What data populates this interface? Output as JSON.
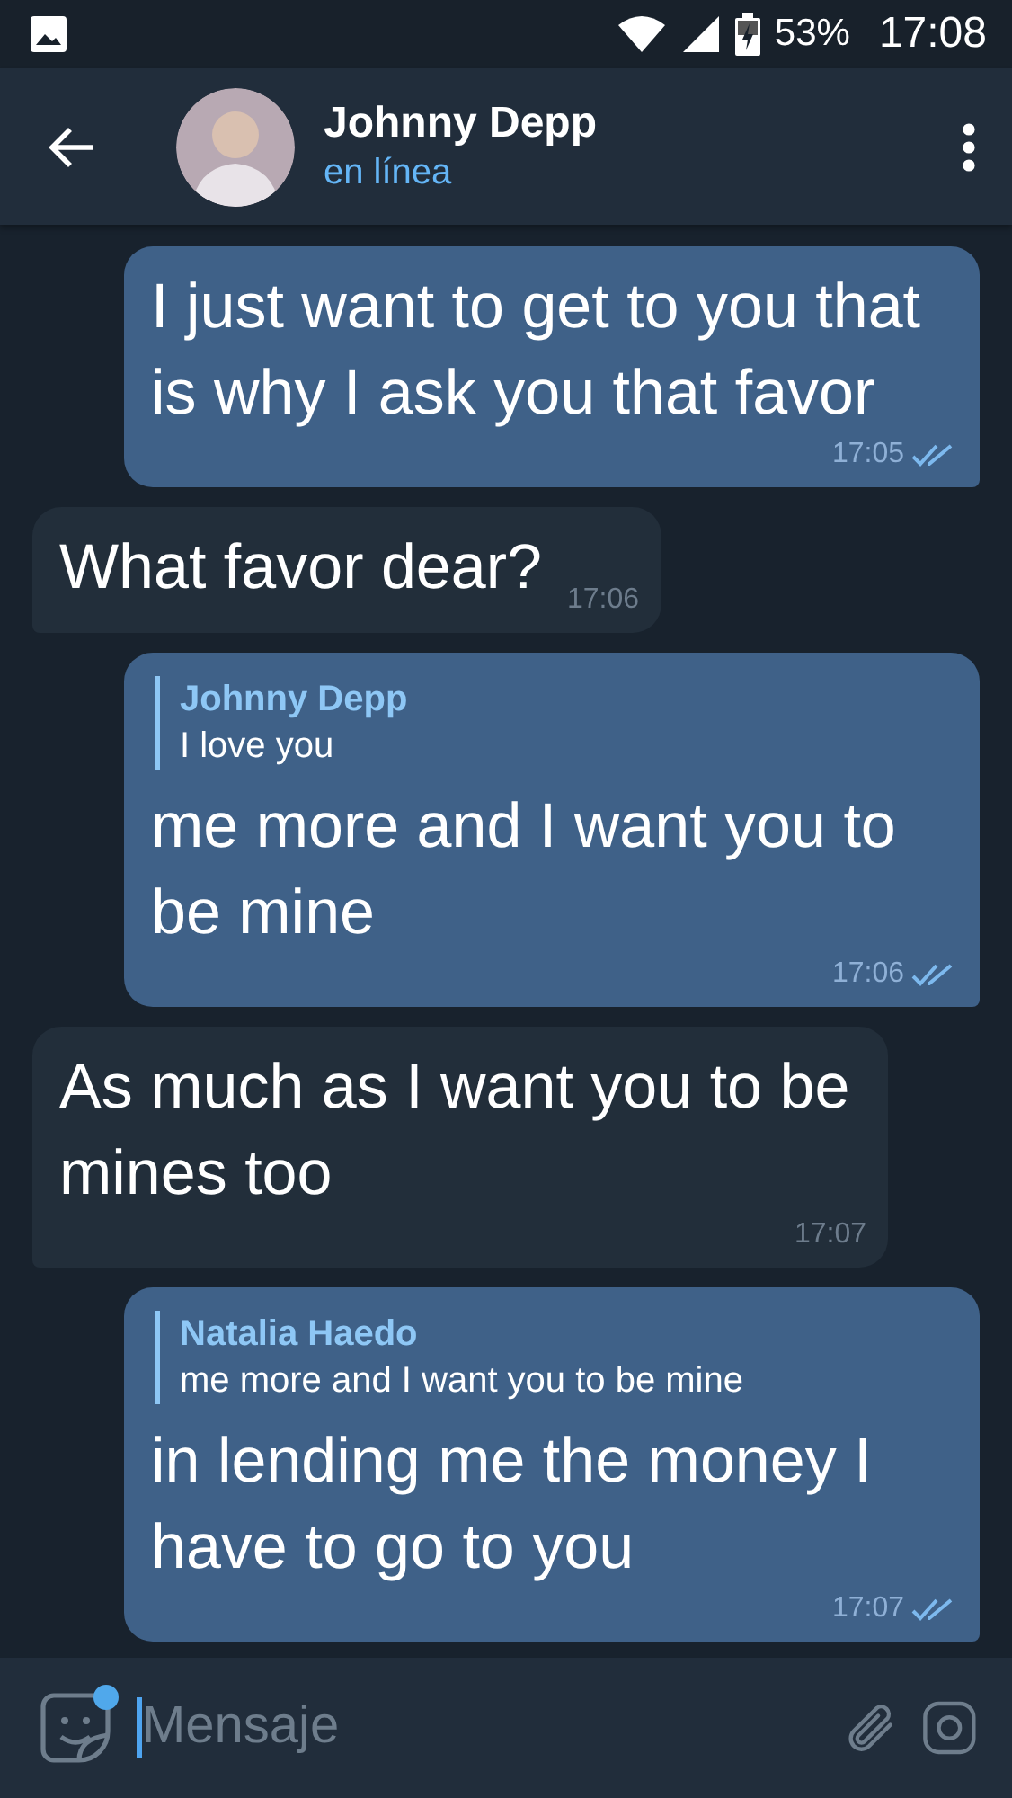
{
  "status_bar": {
    "battery": "53%",
    "time": "17:08"
  },
  "header": {
    "name": "Johnny Depp",
    "status": "en línea"
  },
  "messages": [
    {
      "kind": "outgoing",
      "text": "I just want to get to you that is why I ask you that favor",
      "time": "17:05",
      "read": true
    },
    {
      "kind": "incoming",
      "text": "What favor dear?",
      "time": "17:06"
    },
    {
      "kind": "outgoing",
      "reply": {
        "name": "Johnny Depp",
        "text": "I love you"
      },
      "text": "me more and I want you to be mine",
      "time": "17:06",
      "read": true
    },
    {
      "kind": "incoming",
      "text": "As much as I want you to be mines too",
      "time": "17:07"
    },
    {
      "kind": "outgoing",
      "reply": {
        "name": "Natalia Haedo",
        "text": "me more and I want you to be mine"
      },
      "text": "in lending me the money I have to go to you",
      "time": "17:07",
      "read": true
    }
  ],
  "composer": {
    "placeholder": "Mensaje",
    "sticker_badge": true
  }
}
